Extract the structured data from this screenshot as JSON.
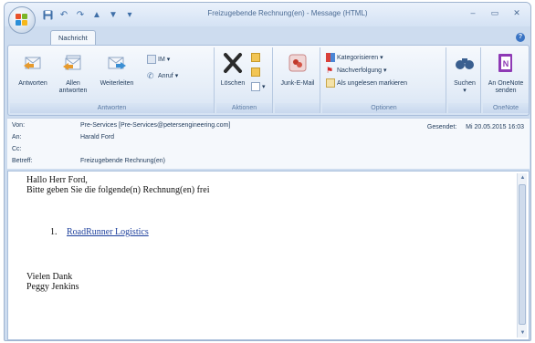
{
  "window": {
    "title": "Freizugebende Rechnung(en) - Message (HTML)",
    "controls": [
      "–",
      "▭",
      "✕"
    ]
  },
  "tabs": [
    {
      "label": "Nachricht"
    }
  ],
  "ribbon": {
    "groups": {
      "respond": {
        "label": "Antworten",
        "reply": "Antworten",
        "reply_all_line1": "Allen",
        "reply_all_line2": "antworten",
        "forward": "Weiterleiten",
        "im": "IM",
        "call": "Anruf"
      },
      "actions": {
        "label": "Aktionen",
        "delete": "Löschen"
      },
      "junk": {
        "junk_mail": "Junk-E-Mail"
      },
      "options": {
        "label": "Optionen",
        "categorize": "Kategorisieren",
        "follow_up": "Nachverfolgung",
        "mark_unread": "Als ungelesen markieren"
      },
      "find": {
        "search": "Suchen"
      },
      "onenote": {
        "label": "OneNote",
        "send_line1": "An OneNote",
        "send_line2": "senden"
      }
    }
  },
  "header": {
    "from_label": "Von:",
    "from_value": "Pre-Services [Pre-Services@petersengineering.com]",
    "to_label": "An:",
    "to_value": "Harald Ford",
    "cc_label": "Cc:",
    "cc_value": "",
    "subject_label": "Betreff:",
    "subject_value": "Freizugebende Rechnung(en)",
    "sent_label": "Gesendet:",
    "sent_value": "Mi 20.05.2015 16:03"
  },
  "message": {
    "greeting": "Hallo Herr Ford,",
    "line1": "Bitte geben Sie die folgende(n) Rechnung(en) frei",
    "list": [
      {
        "number": "1.",
        "text": "RoadRunner Logistics"
      }
    ],
    "closing1": "Vielen Dank",
    "closing2": "Peggy Jenkins"
  },
  "colors": {
    "frame": "#cddcef",
    "ribbon": "#e6eef8",
    "link": "#1d3f9c"
  }
}
